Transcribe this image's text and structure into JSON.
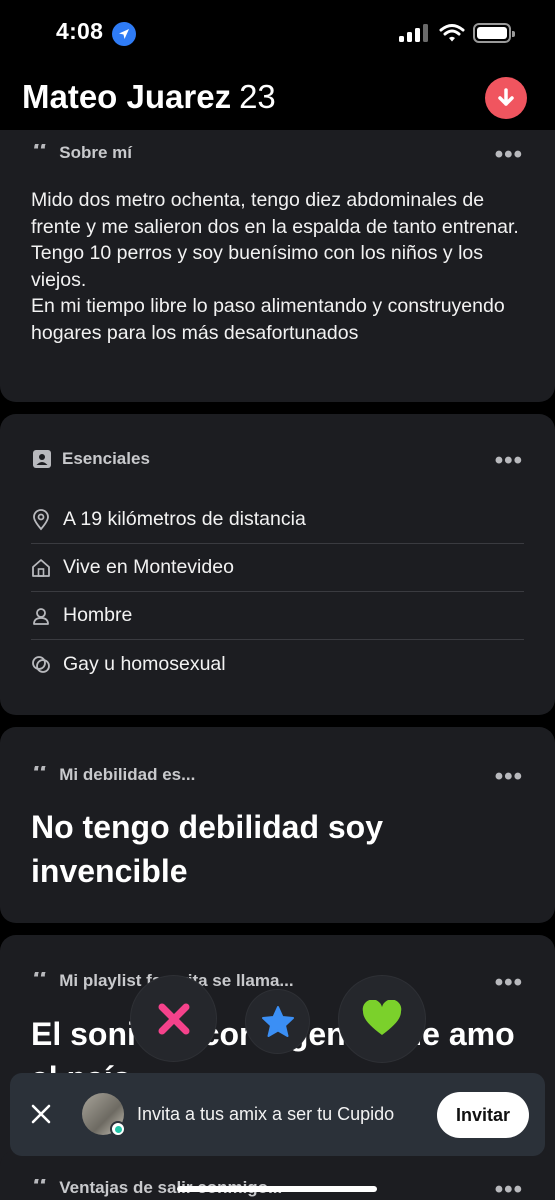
{
  "status_bar": {
    "time": "4:08"
  },
  "profile": {
    "name": "Mateo Juarez",
    "age": "23"
  },
  "about": {
    "title": "Sobre mí",
    "text": "Mido dos metro ochenta, tengo diez abdominales de frente y me salieron dos en la espalda de tanto entrenar. Tengo 10 perros y soy buenísimo con los niños y los viejos.\nEn mi tiempo libre lo paso alimentando y construyendo hogares para los más desafortunados"
  },
  "essentials": {
    "title": "Esenciales",
    "items": [
      {
        "icon": "location-pin-icon",
        "label": "A 19 kilómetros de distancia"
      },
      {
        "icon": "home-icon",
        "label": "Vive en Montevideo"
      },
      {
        "icon": "person-icon",
        "label": "Hombre"
      },
      {
        "icon": "orientation-icon",
        "label": "Gay u homosexual"
      }
    ]
  },
  "prompt1": {
    "title": "Mi debilidad es...",
    "answer": "No tengo debilidad soy invencible"
  },
  "prompt2": {
    "title": "Mi playlist favorita se llama...",
    "answer": "El sonido acorta gente que amo al país"
  },
  "prompt3": {
    "title": "Ventajas de salir conmigo..."
  },
  "actions": {
    "nope": "nope-icon",
    "super_like": "star-icon",
    "like": "heart-icon"
  },
  "invite": {
    "text": "Invita a tus amix a ser tu Cupido",
    "button": "Invitar"
  },
  "colors": {
    "accent": "#f0555f",
    "card": "#1c1d21",
    "nope": "#f5428b",
    "star": "#3b8ff5",
    "heart": "#7bd12b"
  }
}
